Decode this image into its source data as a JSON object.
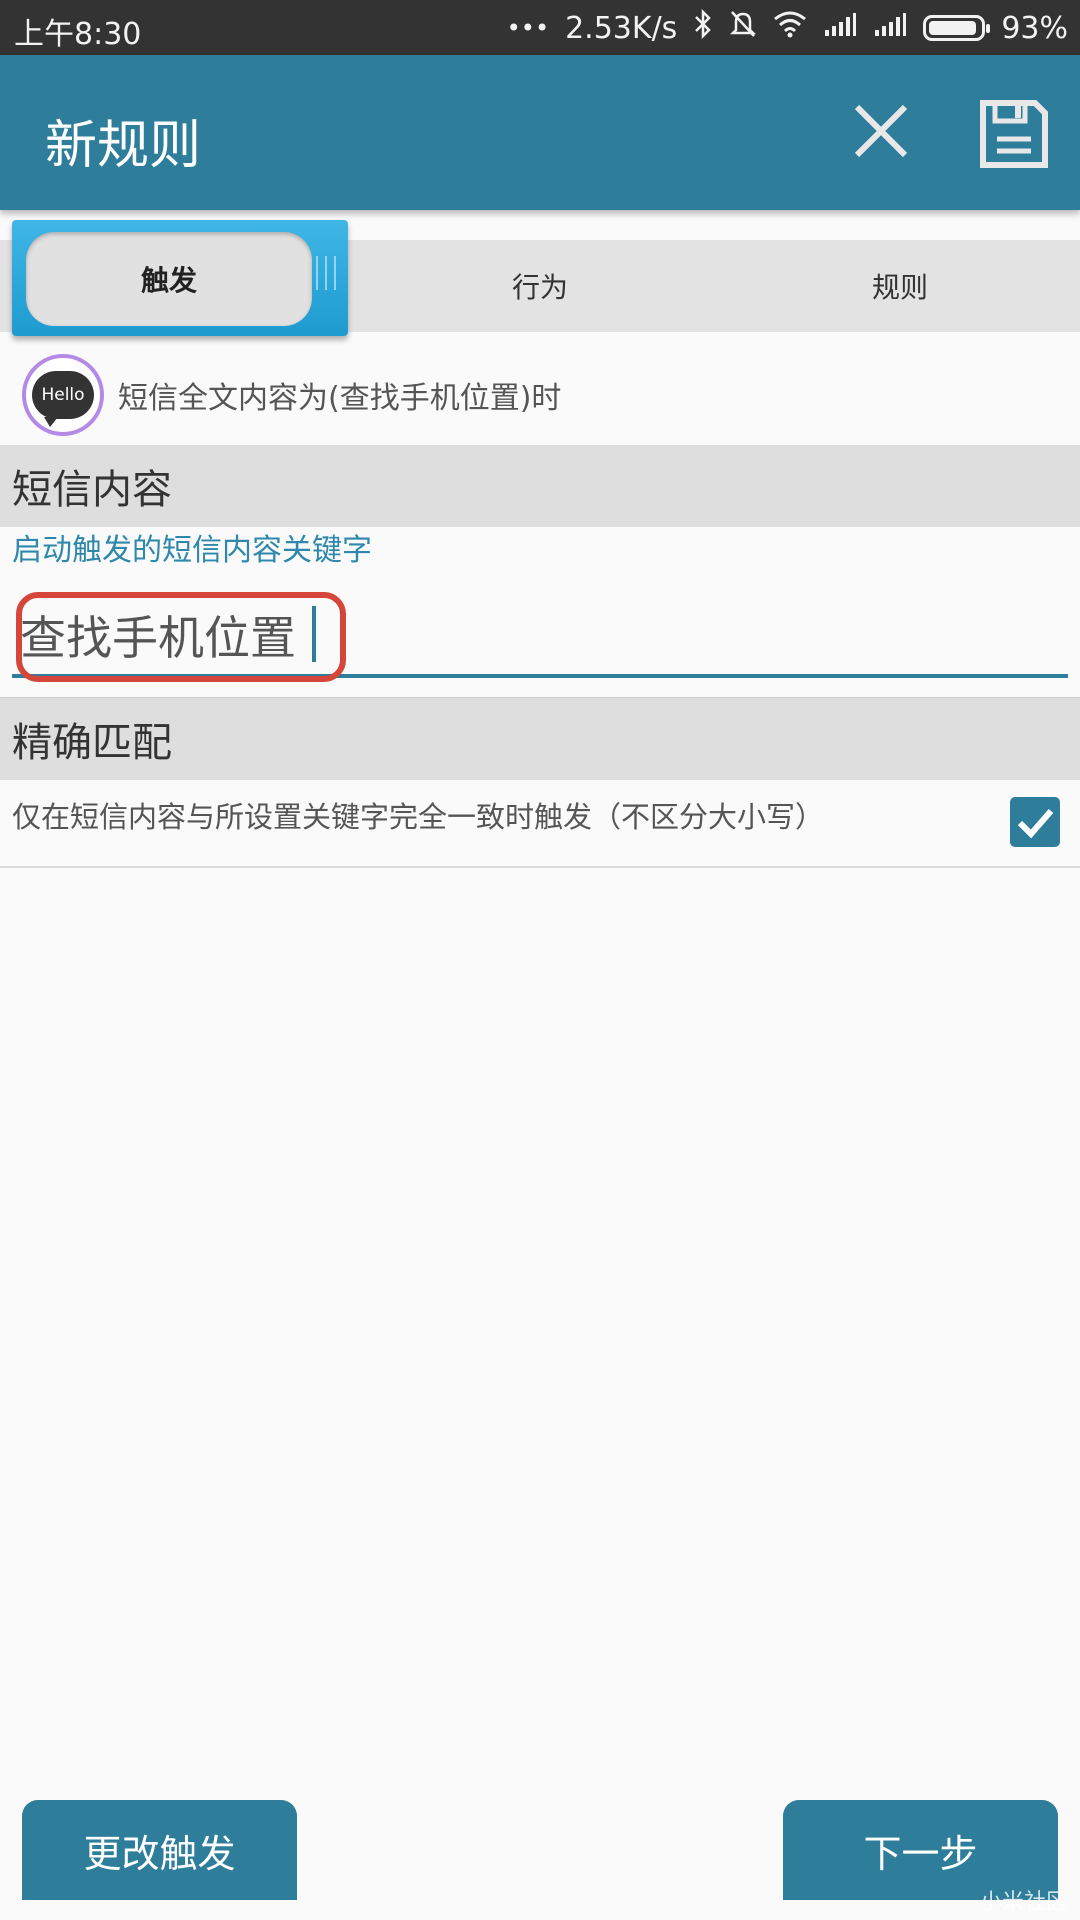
{
  "status_bar": {
    "time": "上午8:30",
    "dots": "•••",
    "speed": "2.53K/s",
    "battery_percent": "93%",
    "battery_level": 0.93
  },
  "app_bar": {
    "title": "新规则",
    "close_icon": "close-icon",
    "save_icon": "save-icon"
  },
  "tabs": [
    {
      "label": "触发",
      "active": true
    },
    {
      "label": "行为",
      "active": false
    },
    {
      "label": "规则",
      "active": false
    }
  ],
  "summary": {
    "icon_text": "Hello",
    "text": "短信全文内容为(查找手机位置)时"
  },
  "sms_content": {
    "header": "短信内容",
    "hint": "启动触发的短信内容关键字",
    "value": "查找手机位置"
  },
  "exact_match": {
    "header": "精确匹配",
    "description": "仅在短信内容与所设置关键字完全一致时触发（不区分大小写）",
    "checked": true
  },
  "buttons": {
    "change_trigger": "更改触发",
    "next_step": "下一步"
  },
  "watermark": "小米社区",
  "colors": {
    "primary": "#2e7d9a",
    "tab_accent": "#1e9bd0",
    "highlight": "#d6453a"
  }
}
